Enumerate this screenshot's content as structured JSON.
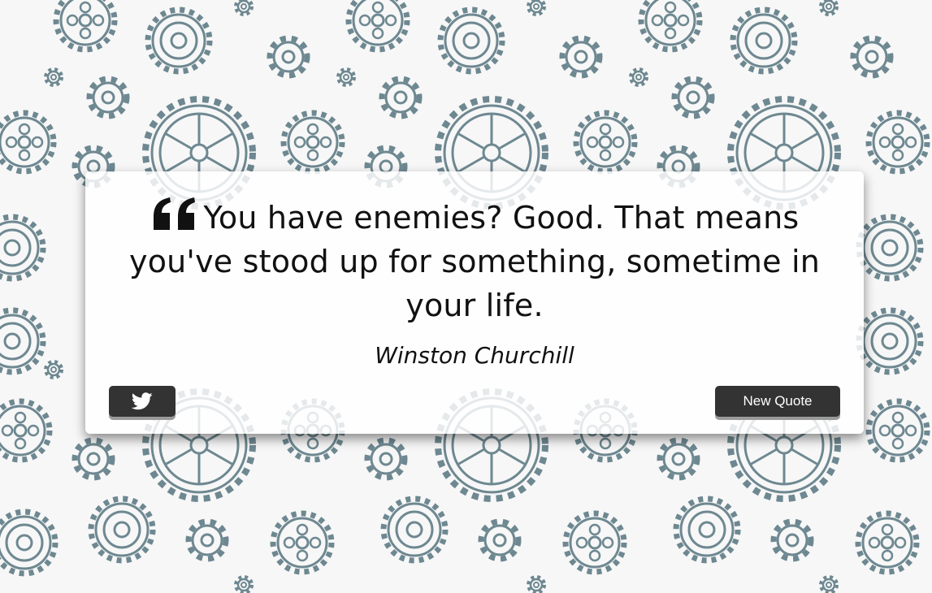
{
  "background": {
    "pattern": "gear-pattern",
    "color": "#6e8891"
  },
  "quote": {
    "text": "You have enemies? Good. That means you've stood up for something, sometime in your life.",
    "author": "Winston Churchill",
    "icon": "quote-left-icon"
  },
  "buttons": {
    "tweet": {
      "icon": "twitter-icon"
    },
    "new_quote": {
      "label": "New Quote"
    }
  },
  "colors": {
    "button_bg": "#333333",
    "button_text": "#ffffff",
    "card_bg": "#ffffff",
    "text": "#111111"
  }
}
